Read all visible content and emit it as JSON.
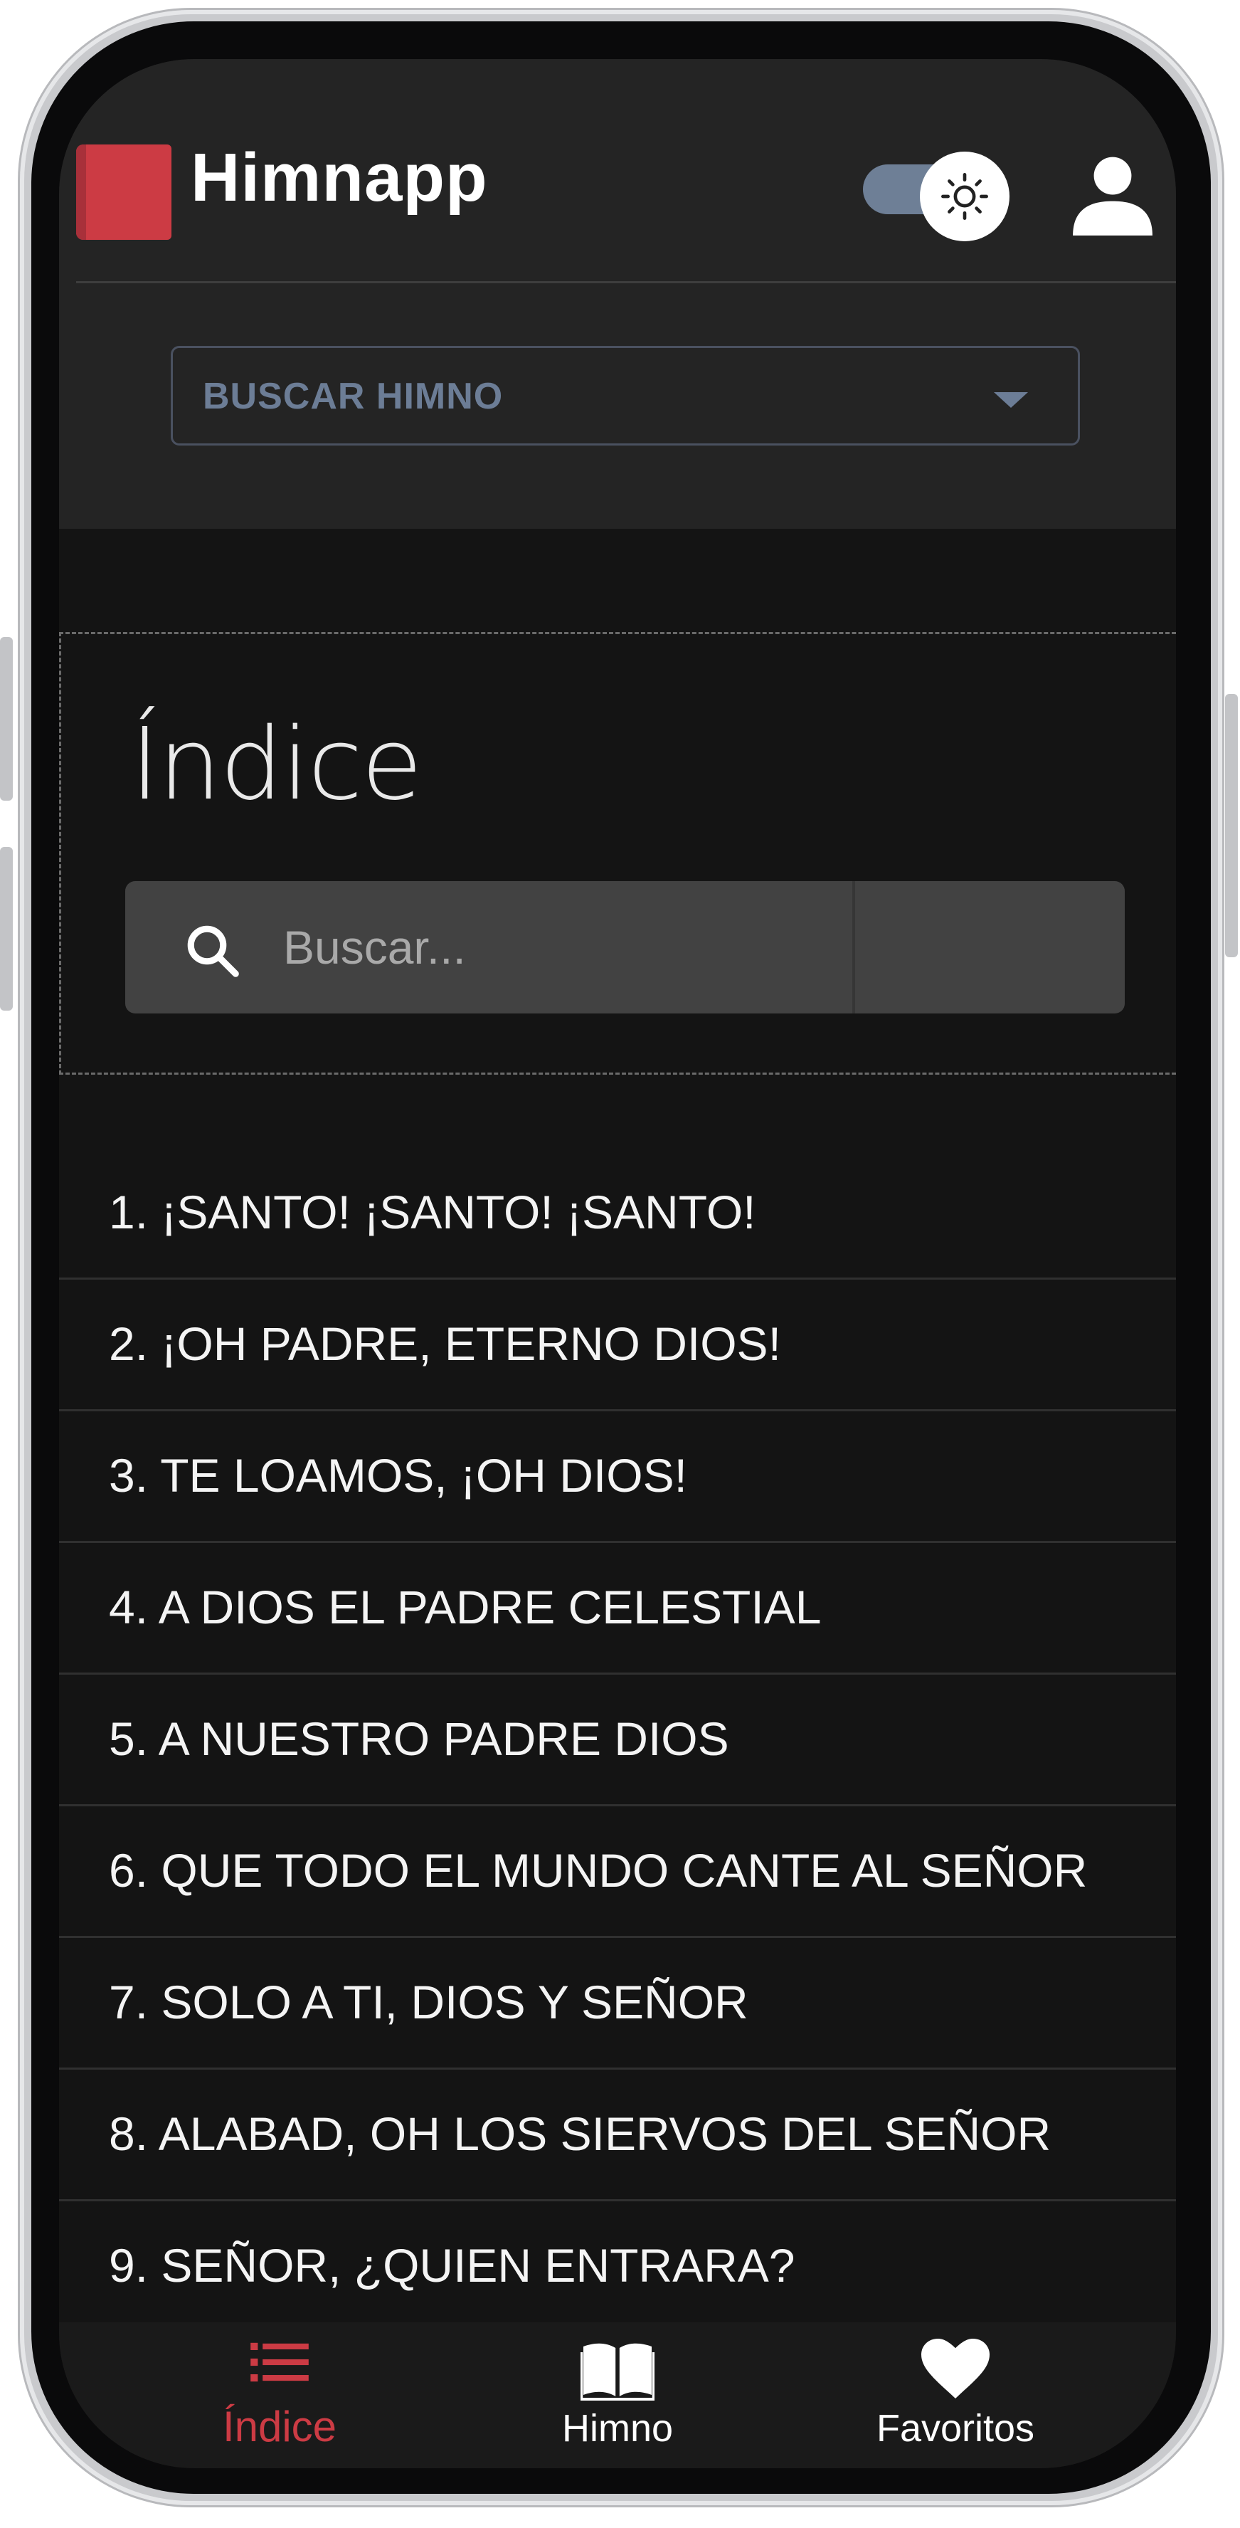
{
  "app": {
    "title": "Himnapp",
    "accent_color": "#cc3b44"
  },
  "header": {
    "hymn_select_label": "BUSCAR HIMNO",
    "theme_toggle_icon": "sun-icon",
    "user_icon": "user-icon"
  },
  "index": {
    "title": "Índice",
    "search_placeholder": "Buscar..."
  },
  "hymns": [
    "1. ¡SANTO! ¡SANTO! ¡SANTO!",
    "2. ¡OH PADRE, ETERNO DIOS!",
    "3. TE LOAMOS, ¡OH DIOS!",
    "4. A DIOS EL PADRE CELESTIAL",
    "5. A NUESTRO PADRE DIOS",
    "6. QUE TODO EL MUNDO CANTE AL SEÑOR",
    "7. SOLO A TI, DIOS Y SEÑOR",
    "8. ALABAD, OH LOS SIERVOS DEL SEÑOR",
    "9. SEÑOR, ¿QUIEN ENTRARA?"
  ],
  "bottom_nav": {
    "items": [
      {
        "label": "Índice",
        "icon": "list-icon",
        "active": true
      },
      {
        "label": "Himno",
        "icon": "book-icon",
        "active": false
      },
      {
        "label": "Favoritos",
        "icon": "heart-icon",
        "active": false
      }
    ]
  }
}
